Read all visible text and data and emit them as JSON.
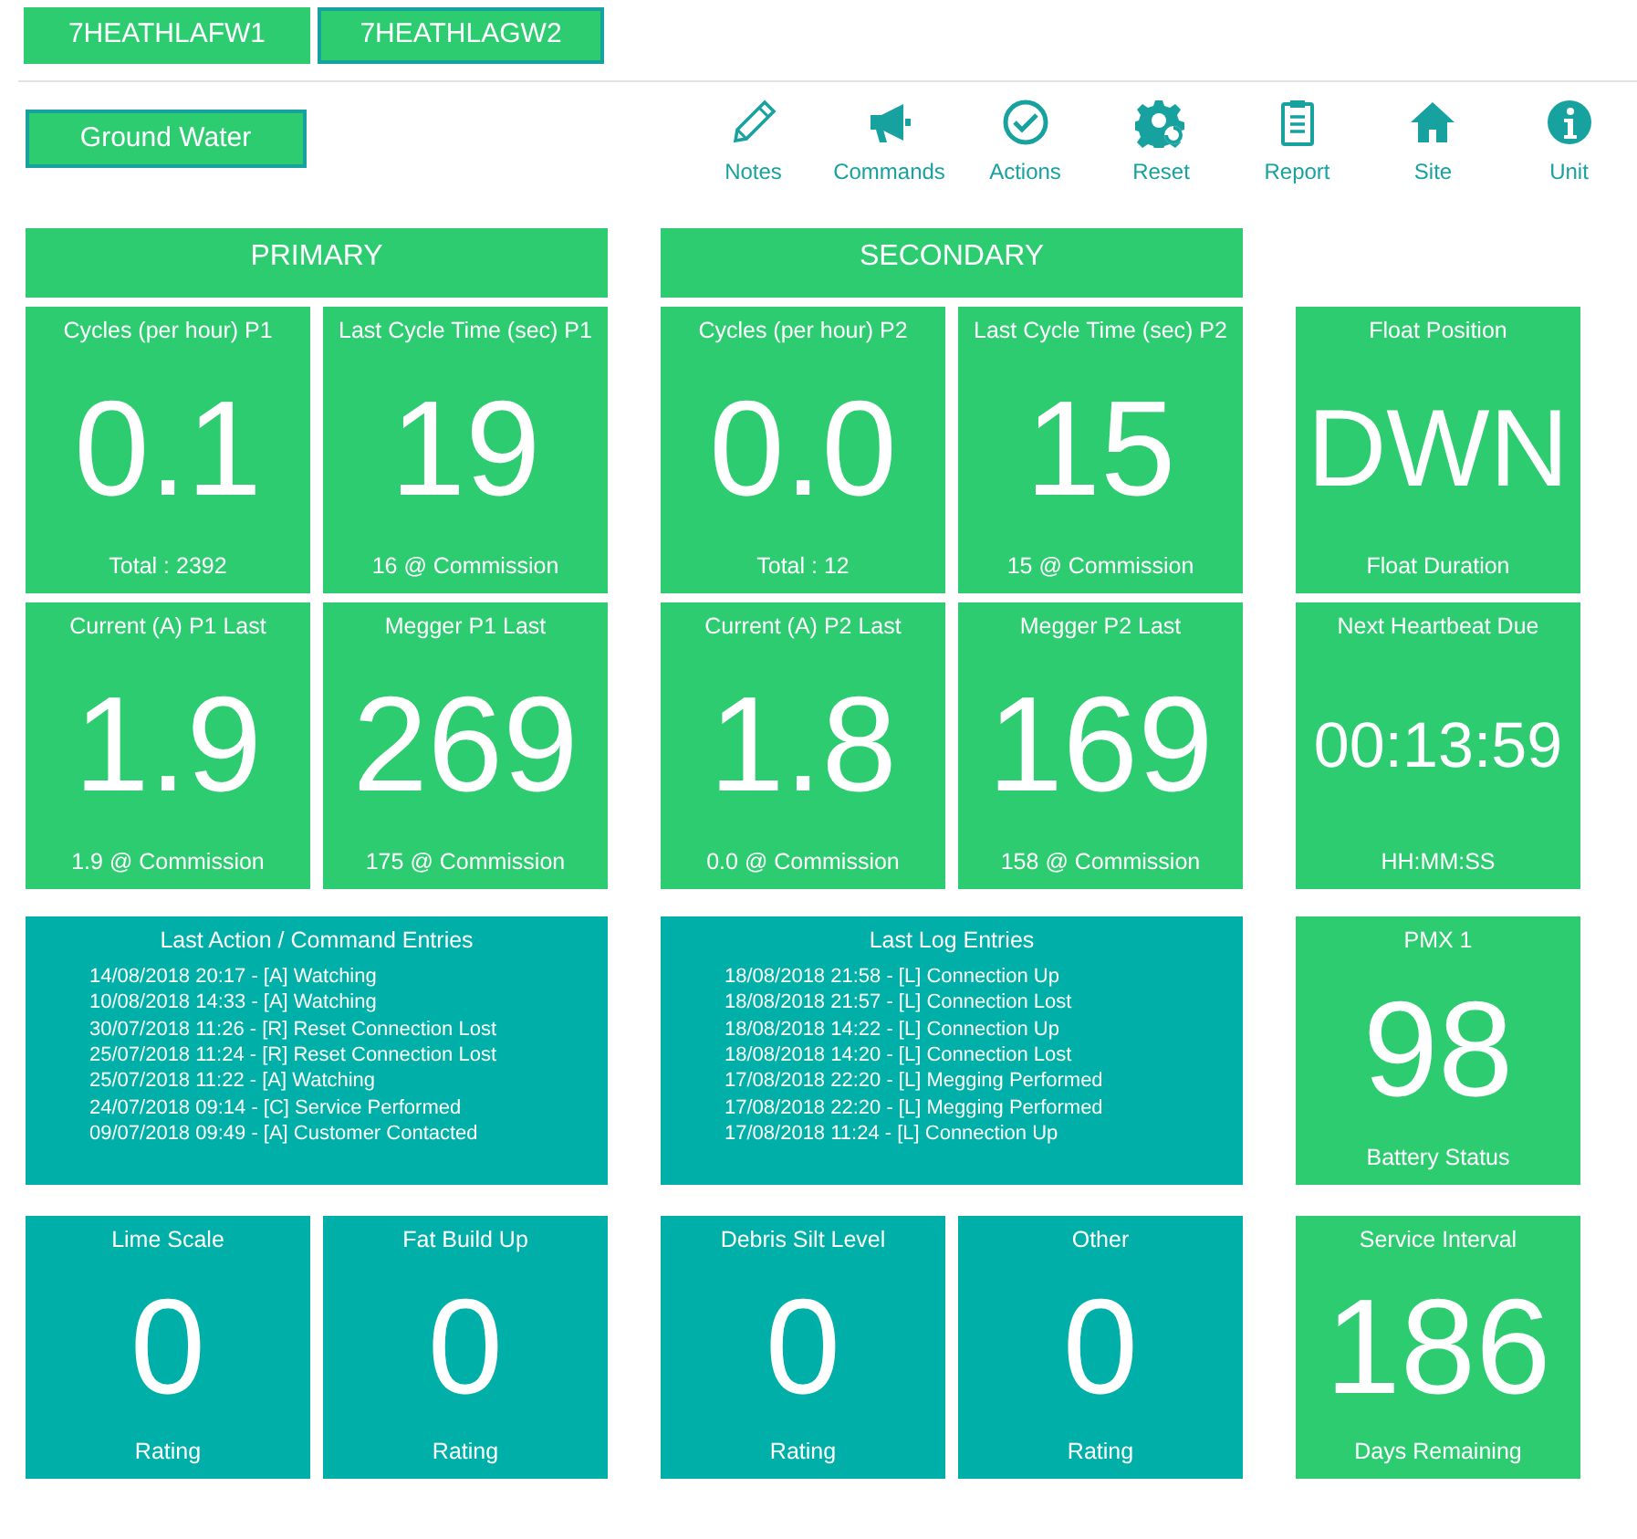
{
  "units": [
    {
      "label": "7HEATHLAFW1",
      "selected": false
    },
    {
      "label": "7HEATHLAGW2",
      "selected": true
    }
  ],
  "category": "Ground Water",
  "toolbar": [
    {
      "kind": "pencil",
      "label": "Notes"
    },
    {
      "kind": "megaphone",
      "label": "Commands"
    },
    {
      "kind": "check",
      "label": "Actions"
    },
    {
      "kind": "gear",
      "label": "Reset"
    },
    {
      "kind": "clipboard",
      "label": "Report"
    },
    {
      "kind": "house",
      "label": "Site"
    },
    {
      "kind": "info",
      "label": "Unit"
    }
  ],
  "panels": [
    {
      "title": "PRIMARY",
      "metrics": [
        {
          "title": "Cycles (per hour) P1",
          "value": "0.1",
          "footer": "Total : 2392",
          "color": "#2ecc71"
        },
        {
          "title": "Last Cycle Time (sec) P1",
          "value": "19",
          "footer": "16 @ Commission",
          "color": "#2ecc71"
        },
        {
          "title": "Current (A) P1 Last",
          "value": "1.9",
          "footer": "1.9 @ Commission",
          "color": "#2ecc71"
        },
        {
          "title": "Megger P1 Last",
          "value": "269",
          "footer": "175 @ Commission",
          "color": "#2ecc71"
        }
      ],
      "log": {
        "title": "Last Action / Command Entries",
        "color": "#00b0a8",
        "entries": [
          "14/08/2018 20:17 - [A] Watching",
          "10/08/2018 14:33 - [A] Watching",
          "30/07/2018 11:26 - [R] Reset Connection Lost",
          "25/07/2018 11:24 - [R] Reset Connection Lost",
          "25/07/2018 11:22 - [A] Watching",
          "24/07/2018 09:14 - [C] Service Performed",
          "09/07/2018 09:49 - [A] Customer Contacted"
        ]
      },
      "ratings": [
        {
          "title": "Lime Scale",
          "value": "0",
          "footer": "Rating",
          "color": "#00b0a8"
        },
        {
          "title": "Fat Build Up",
          "value": "0",
          "footer": "Rating",
          "color": "#00b0a8"
        }
      ]
    },
    {
      "title": "SECONDARY",
      "metrics": [
        {
          "title": "Cycles (per hour) P2",
          "value": "0.0",
          "footer": "Total : 12",
          "color": "#2ecc71"
        },
        {
          "title": "Last Cycle Time (sec) P2",
          "value": "15",
          "footer": "15 @ Commission",
          "color": "#2ecc71"
        },
        {
          "title": "Current (A) P2 Last",
          "value": "1.8",
          "footer": "0.0 @ Commission",
          "color": "#2ecc71"
        },
        {
          "title": "Megger P2 Last",
          "value": "169",
          "footer": "158 @ Commission",
          "color": "#2ecc71"
        }
      ],
      "log": {
        "title": "Last Log Entries",
        "color": "#00b0a8",
        "entries": [
          "18/08/2018 21:58 - [L] Connection Up",
          "18/08/2018 21:57 - [L] Connection Lost",
          "18/08/2018 14:22 - [L] Connection Up",
          "18/08/2018 14:20 - [L] Connection Lost",
          "17/08/2018 22:20 - [L] Megging Performed",
          "17/08/2018 22:20 - [L] Megging Performed",
          "17/08/2018 11:24 - [L] Connection Up"
        ]
      },
      "ratings": [
        {
          "title": "Debris Silt Level",
          "value": "0",
          "footer": "Rating",
          "color": "#00b0a8"
        },
        {
          "title": "Other",
          "value": "0",
          "footer": "Rating",
          "color": "#00b0a8"
        }
      ]
    }
  ],
  "side_tiles": [
    {
      "title": "Float Position",
      "value": "DWN",
      "footer": "Float Duration",
      "color": "#2ecc71",
      "kind": "text"
    },
    {
      "title": "Next Heartbeat Due",
      "value": "00:13:59",
      "footer": "HH:MM:SS",
      "color": "#2ecc71",
      "kind": "time"
    },
    {
      "title": "PMX 1",
      "value": "98",
      "footer": "Battery Status",
      "color": "#2ecc71",
      "kind": "number"
    },
    {
      "title": "Service Interval",
      "value": "186",
      "footer": "Days Remaining",
      "color": "#2ecc71",
      "kind": "number"
    }
  ]
}
